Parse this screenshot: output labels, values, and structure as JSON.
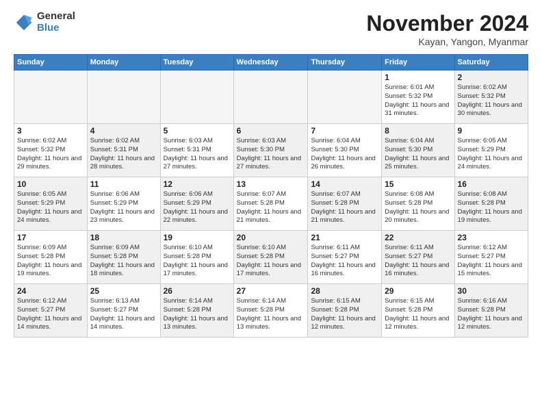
{
  "logo": {
    "general": "General",
    "blue": "Blue"
  },
  "title": {
    "month": "November 2024",
    "location": "Kayan, Yangon, Myanmar"
  },
  "headers": [
    "Sunday",
    "Monday",
    "Tuesday",
    "Wednesday",
    "Thursday",
    "Friday",
    "Saturday"
  ],
  "weeks": [
    [
      {
        "day": "",
        "info": "",
        "empty": true
      },
      {
        "day": "",
        "info": "",
        "empty": true
      },
      {
        "day": "",
        "info": "",
        "empty": true
      },
      {
        "day": "",
        "info": "",
        "empty": true
      },
      {
        "day": "",
        "info": "",
        "empty": true
      },
      {
        "day": "1",
        "info": "Sunrise: 6:01 AM\nSunset: 5:32 PM\nDaylight: 11 hours and 31 minutes."
      },
      {
        "day": "2",
        "info": "Sunrise: 6:02 AM\nSunset: 5:32 PM\nDaylight: 11 hours and 30 minutes."
      }
    ],
    [
      {
        "day": "3",
        "info": "Sunrise: 6:02 AM\nSunset: 5:32 PM\nDaylight: 11 hours and 29 minutes."
      },
      {
        "day": "4",
        "info": "Sunrise: 6:02 AM\nSunset: 5:31 PM\nDaylight: 11 hours and 28 minutes."
      },
      {
        "day": "5",
        "info": "Sunrise: 6:03 AM\nSunset: 5:31 PM\nDaylight: 11 hours and 27 minutes."
      },
      {
        "day": "6",
        "info": "Sunrise: 6:03 AM\nSunset: 5:30 PM\nDaylight: 11 hours and 27 minutes."
      },
      {
        "day": "7",
        "info": "Sunrise: 6:04 AM\nSunset: 5:30 PM\nDaylight: 11 hours and 26 minutes."
      },
      {
        "day": "8",
        "info": "Sunrise: 6:04 AM\nSunset: 5:30 PM\nDaylight: 11 hours and 25 minutes."
      },
      {
        "day": "9",
        "info": "Sunrise: 6:05 AM\nSunset: 5:29 PM\nDaylight: 11 hours and 24 minutes."
      }
    ],
    [
      {
        "day": "10",
        "info": "Sunrise: 6:05 AM\nSunset: 5:29 PM\nDaylight: 11 hours and 24 minutes."
      },
      {
        "day": "11",
        "info": "Sunrise: 6:06 AM\nSunset: 5:29 PM\nDaylight: 11 hours and 23 minutes."
      },
      {
        "day": "12",
        "info": "Sunrise: 6:06 AM\nSunset: 5:29 PM\nDaylight: 11 hours and 22 minutes."
      },
      {
        "day": "13",
        "info": "Sunrise: 6:07 AM\nSunset: 5:28 PM\nDaylight: 11 hours and 21 minutes."
      },
      {
        "day": "14",
        "info": "Sunrise: 6:07 AM\nSunset: 5:28 PM\nDaylight: 11 hours and 21 minutes."
      },
      {
        "day": "15",
        "info": "Sunrise: 6:08 AM\nSunset: 5:28 PM\nDaylight: 11 hours and 20 minutes."
      },
      {
        "day": "16",
        "info": "Sunrise: 6:08 AM\nSunset: 5:28 PM\nDaylight: 11 hours and 19 minutes."
      }
    ],
    [
      {
        "day": "17",
        "info": "Sunrise: 6:09 AM\nSunset: 5:28 PM\nDaylight: 11 hours and 19 minutes."
      },
      {
        "day": "18",
        "info": "Sunrise: 6:09 AM\nSunset: 5:28 PM\nDaylight: 11 hours and 18 minutes."
      },
      {
        "day": "19",
        "info": "Sunrise: 6:10 AM\nSunset: 5:28 PM\nDaylight: 11 hours and 17 minutes."
      },
      {
        "day": "20",
        "info": "Sunrise: 6:10 AM\nSunset: 5:28 PM\nDaylight: 11 hours and 17 minutes."
      },
      {
        "day": "21",
        "info": "Sunrise: 6:11 AM\nSunset: 5:27 PM\nDaylight: 11 hours and 16 minutes."
      },
      {
        "day": "22",
        "info": "Sunrise: 6:11 AM\nSunset: 5:27 PM\nDaylight: 11 hours and 16 minutes."
      },
      {
        "day": "23",
        "info": "Sunrise: 6:12 AM\nSunset: 5:27 PM\nDaylight: 11 hours and 15 minutes."
      }
    ],
    [
      {
        "day": "24",
        "info": "Sunrise: 6:12 AM\nSunset: 5:27 PM\nDaylight: 11 hours and 14 minutes."
      },
      {
        "day": "25",
        "info": "Sunrise: 6:13 AM\nSunset: 5:27 PM\nDaylight: 11 hours and 14 minutes."
      },
      {
        "day": "26",
        "info": "Sunrise: 6:14 AM\nSunset: 5:28 PM\nDaylight: 11 hours and 13 minutes."
      },
      {
        "day": "27",
        "info": "Sunrise: 6:14 AM\nSunset: 5:28 PM\nDaylight: 11 hours and 13 minutes."
      },
      {
        "day": "28",
        "info": "Sunrise: 6:15 AM\nSunset: 5:28 PM\nDaylight: 11 hours and 12 minutes."
      },
      {
        "day": "29",
        "info": "Sunrise: 6:15 AM\nSunset: 5:28 PM\nDaylight: 11 hours and 12 minutes."
      },
      {
        "day": "30",
        "info": "Sunrise: 6:16 AM\nSunset: 5:28 PM\nDaylight: 11 hours and 12 minutes."
      }
    ]
  ]
}
